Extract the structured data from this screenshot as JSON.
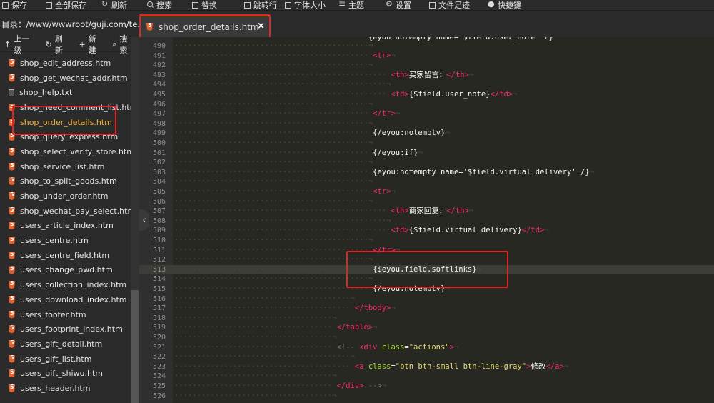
{
  "toolbar": {
    "items": [
      {
        "label": "保存",
        "icon": "save-icon"
      },
      {
        "label": "全部保存",
        "icon": "save-all-icon"
      },
      {
        "label": "刷新",
        "icon": "refresh-icon"
      },
      {
        "label": "搜索",
        "icon": "search-icon"
      },
      {
        "label": "替换",
        "icon": "replace-icon"
      },
      {
        "label": "跳转行",
        "icon": "goto-line-icon"
      },
      {
        "label": "字体大小",
        "icon": "font-size-icon"
      },
      {
        "label": "主题",
        "icon": "theme-icon"
      },
      {
        "label": "设置",
        "icon": "gear-icon"
      },
      {
        "label": "文件足迹",
        "icon": "history-icon"
      },
      {
        "label": "快捷键",
        "icon": "info-icon"
      }
    ]
  },
  "path": {
    "label": "目录：/www/wwwroot/guji.com/te..."
  },
  "tab": {
    "title": "shop_order_details.htm",
    "close": "×"
  },
  "sidebar": {
    "actions": [
      {
        "label": "上一级",
        "icon": "up-level-icon"
      },
      {
        "label": "刷新",
        "icon": "refresh-icon"
      },
      {
        "label": "新建",
        "icon": "plus-icon"
      },
      {
        "label": "搜索",
        "icon": "search-icon"
      }
    ],
    "files": [
      {
        "name": "shop_edit_address.htm",
        "type": "html"
      },
      {
        "name": "shop_get_wechat_addr.htm",
        "type": "html"
      },
      {
        "name": "shop_help.txt",
        "type": "txt"
      },
      {
        "name": "shop_need_comment_list.htm",
        "type": "html"
      },
      {
        "name": "shop_order_details.htm",
        "type": "html",
        "active": true
      },
      {
        "name": "shop_query_express.htm",
        "type": "html"
      },
      {
        "name": "shop_select_verify_store.htm",
        "type": "html"
      },
      {
        "name": "shop_service_list.htm",
        "type": "html"
      },
      {
        "name": "shop_to_split_goods.htm",
        "type": "html"
      },
      {
        "name": "shop_under_order.htm",
        "type": "html"
      },
      {
        "name": "shop_wechat_pay_select.htm",
        "type": "html"
      },
      {
        "name": "users_article_index.htm",
        "type": "html"
      },
      {
        "name": "users_centre.htm",
        "type": "html"
      },
      {
        "name": "users_centre_field.htm",
        "type": "html"
      },
      {
        "name": "users_change_pwd.htm",
        "type": "html"
      },
      {
        "name": "users_collection_index.htm",
        "type": "html"
      },
      {
        "name": "users_download_index.htm",
        "type": "html"
      },
      {
        "name": "users_footer.htm",
        "type": "html"
      },
      {
        "name": "users_footprint_index.htm",
        "type": "html"
      },
      {
        "name": "users_gift_detail.htm",
        "type": "html"
      },
      {
        "name": "users_gift_list.htm",
        "type": "html"
      },
      {
        "name": "users_gift_shiwu.htm",
        "type": "html"
      },
      {
        "name": "users_header.htm",
        "type": "html"
      }
    ]
  },
  "editor": {
    "lines": [
      {
        "n": "490",
        "indent": 11,
        "parts": []
      },
      {
        "n": "491",
        "indent": 11,
        "parts": [
          [
            "tag",
            "<tr>"
          ]
        ]
      },
      {
        "n": "492",
        "indent": 11,
        "parts": []
      },
      {
        "n": "493",
        "indent": 12,
        "parts": [
          [
            "tag",
            "<th>"
          ],
          [
            "plain",
            "买家留言："
          ],
          [
            "tag",
            "</th>"
          ]
        ]
      },
      {
        "n": "494",
        "indent": 12,
        "parts": []
      },
      {
        "n": "495",
        "indent": 12,
        "parts": [
          [
            "tag",
            "<td>"
          ],
          [
            "plain",
            "{$field.user_note}"
          ],
          [
            "tag",
            "</td>"
          ]
        ]
      },
      {
        "n": "496",
        "indent": 11,
        "parts": []
      },
      {
        "n": "497",
        "indent": 11,
        "parts": [
          [
            "tag",
            "</tr>"
          ]
        ]
      },
      {
        "n": "498",
        "indent": 11,
        "parts": []
      },
      {
        "n": "499",
        "indent": 11,
        "parts": [
          [
            "plain",
            "{/eyou:notempty}"
          ]
        ]
      },
      {
        "n": "500",
        "indent": 11,
        "parts": []
      },
      {
        "n": "501",
        "indent": 11,
        "parts": [
          [
            "plain",
            "{/eyou:if}"
          ]
        ]
      },
      {
        "n": "502",
        "indent": 11,
        "parts": []
      },
      {
        "n": "503",
        "indent": 11,
        "parts": [
          [
            "plain",
            "{eyou:notempty name='$field.virtual_delivery' /}"
          ]
        ]
      },
      {
        "n": "504",
        "indent": 11,
        "parts": []
      },
      {
        "n": "505",
        "indent": 11,
        "parts": [
          [
            "tag",
            "<tr>"
          ]
        ]
      },
      {
        "n": "506",
        "indent": 11,
        "parts": []
      },
      {
        "n": "507",
        "indent": 12,
        "parts": [
          [
            "tag",
            "<th>"
          ],
          [
            "plain",
            "商家回复："
          ],
          [
            "tag",
            "</th>"
          ]
        ]
      },
      {
        "n": "508",
        "indent": 12,
        "parts": []
      },
      {
        "n": "509",
        "indent": 12,
        "parts": [
          [
            "tag",
            "<td>"
          ],
          [
            "plain",
            "{$field.virtual_delivery}"
          ],
          [
            "tag",
            "</td>"
          ]
        ]
      },
      {
        "n": "510",
        "indent": 11,
        "parts": []
      },
      {
        "n": "511",
        "indent": 11,
        "parts": [
          [
            "tag",
            "</tr>"
          ]
        ]
      },
      {
        "n": "512",
        "indent": 11,
        "parts": []
      },
      {
        "n": "513",
        "indent": 11,
        "parts": [
          [
            "plain",
            "{$eyou.field.softlinks}"
          ]
        ],
        "highlight": true
      },
      {
        "n": "514",
        "indent": 11,
        "parts": []
      },
      {
        "n": "515",
        "indent": 11,
        "parts": [
          [
            "plain",
            "{/eyou:notempty}"
          ]
        ]
      },
      {
        "n": "516",
        "indent": 10,
        "parts": []
      },
      {
        "n": "517",
        "indent": 10,
        "parts": [
          [
            "tag",
            "</tbody>"
          ]
        ]
      },
      {
        "n": "518",
        "indent": 9,
        "parts": []
      },
      {
        "n": "519",
        "indent": 9,
        "parts": [
          [
            "tag",
            "</table>"
          ]
        ]
      },
      {
        "n": "520",
        "indent": 9,
        "parts": []
      },
      {
        "n": "521",
        "indent": 9,
        "parts": [
          [
            "comment",
            "<!-- "
          ],
          [
            "tag",
            "<div "
          ],
          [
            "attr",
            "class"
          ],
          [
            "plain",
            "="
          ],
          [
            "str",
            "\"actions\""
          ],
          [
            "tag",
            ">"
          ]
        ]
      },
      {
        "n": "522",
        "indent": 10,
        "parts": []
      },
      {
        "n": "523",
        "indent": 10,
        "parts": [
          [
            "tag",
            "<a "
          ],
          [
            "attr",
            "class"
          ],
          [
            "plain",
            "="
          ],
          [
            "str",
            "\"btn btn-small btn-line-gray\""
          ],
          [
            "tag",
            ">"
          ],
          [
            "plain",
            "修改"
          ],
          [
            "tag",
            "</a>"
          ]
        ]
      },
      {
        "n": "524",
        "indent": 9,
        "parts": []
      },
      {
        "n": "525",
        "indent": 9,
        "parts": [
          [
            "tag",
            "</div>"
          ],
          [
            "comment",
            " -->"
          ]
        ]
      },
      {
        "n": "526",
        "indent": 9,
        "parts": []
      }
    ],
    "partial_top_line": "{eyou:notempty name='$field.user_note' /}"
  }
}
